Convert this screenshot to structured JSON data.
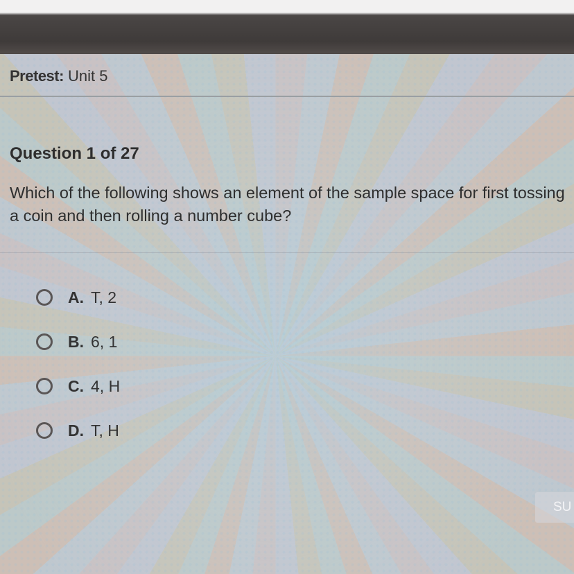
{
  "header": {
    "prefix": "Pretest:",
    "title": "Unit 5"
  },
  "question": {
    "counter": "Question 1 of 27",
    "text": "Which of the following shows an element of the sample space for first tossing a coin and then rolling a number cube?"
  },
  "options": [
    {
      "letter": "A.",
      "text": "T, 2"
    },
    {
      "letter": "B.",
      "text": "6, 1"
    },
    {
      "letter": "C.",
      "text": "4, H"
    },
    {
      "letter": "D.",
      "text": "T, H"
    }
  ],
  "submit": {
    "label": "SU"
  }
}
